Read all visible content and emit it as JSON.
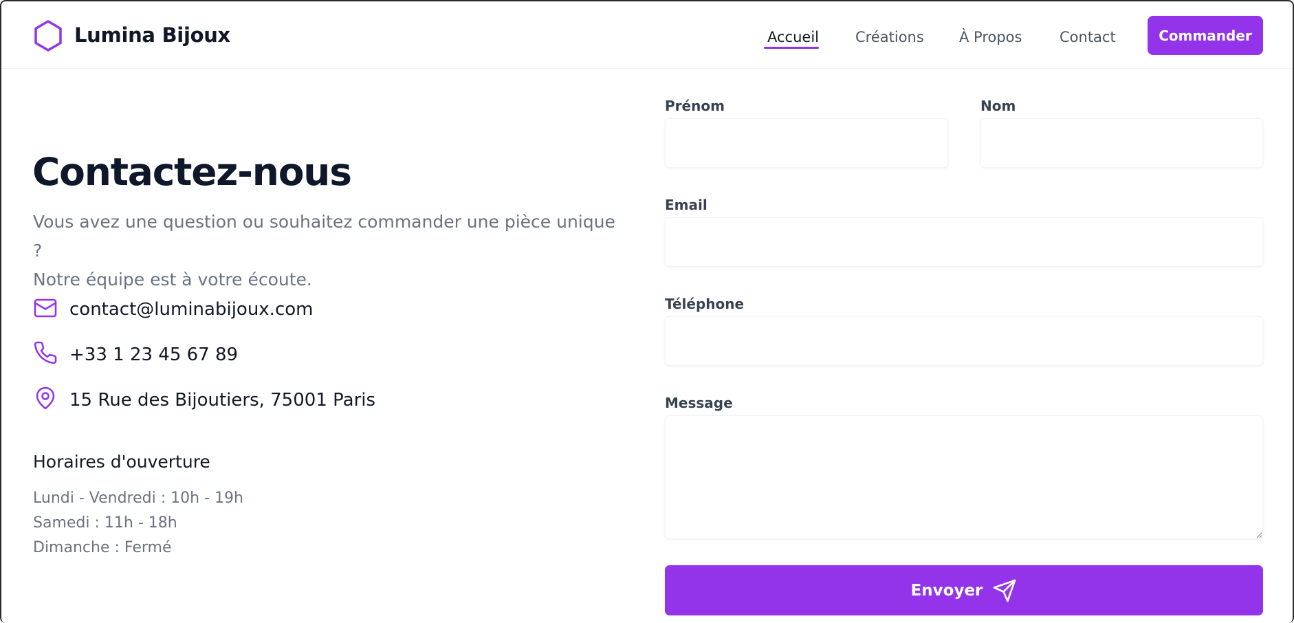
{
  "header": {
    "brand": "Lumina Bijoux",
    "logo_icon": "hexagon-icon",
    "nav": [
      {
        "label": "Accueil",
        "active": true
      },
      {
        "label": "Créations",
        "active": false
      },
      {
        "label": "À Propos",
        "active": false
      },
      {
        "label": "Contact",
        "active": false
      }
    ],
    "cta_label": "Commander"
  },
  "contact": {
    "title": "Contactez-nous",
    "subtitle_line1": "Vous avez une question ou souhaitez commander une pièce unique ?",
    "subtitle_line2": "Notre équipe est à votre écoute.",
    "items": [
      {
        "icon": "mail-icon",
        "text": "contact@luminabijoux.com"
      },
      {
        "icon": "phone-icon",
        "text": "+33 1 23 45 67 89"
      },
      {
        "icon": "map-pin-icon",
        "text": "15 Rue des Bijoutiers, 75001 Paris"
      }
    ],
    "hours_title": "Horaires d'ouverture",
    "hours": [
      "Lundi - Vendredi : 10h - 19h",
      "Samedi : 11h - 18h",
      "Dimanche : Fermé"
    ]
  },
  "form": {
    "first_name_label": "Prénom",
    "first_name_value": "",
    "last_name_label": "Nom",
    "last_name_value": "",
    "email_label": "Email",
    "email_value": "",
    "phone_label": "Téléphone",
    "phone_value": "",
    "message_label": "Message",
    "message_value": "",
    "submit_label": "Envoyer",
    "submit_icon": "send-icon"
  },
  "colors": {
    "accent": "#9333ea",
    "text_dark": "#0f172a",
    "text_muted": "#6b7280"
  }
}
